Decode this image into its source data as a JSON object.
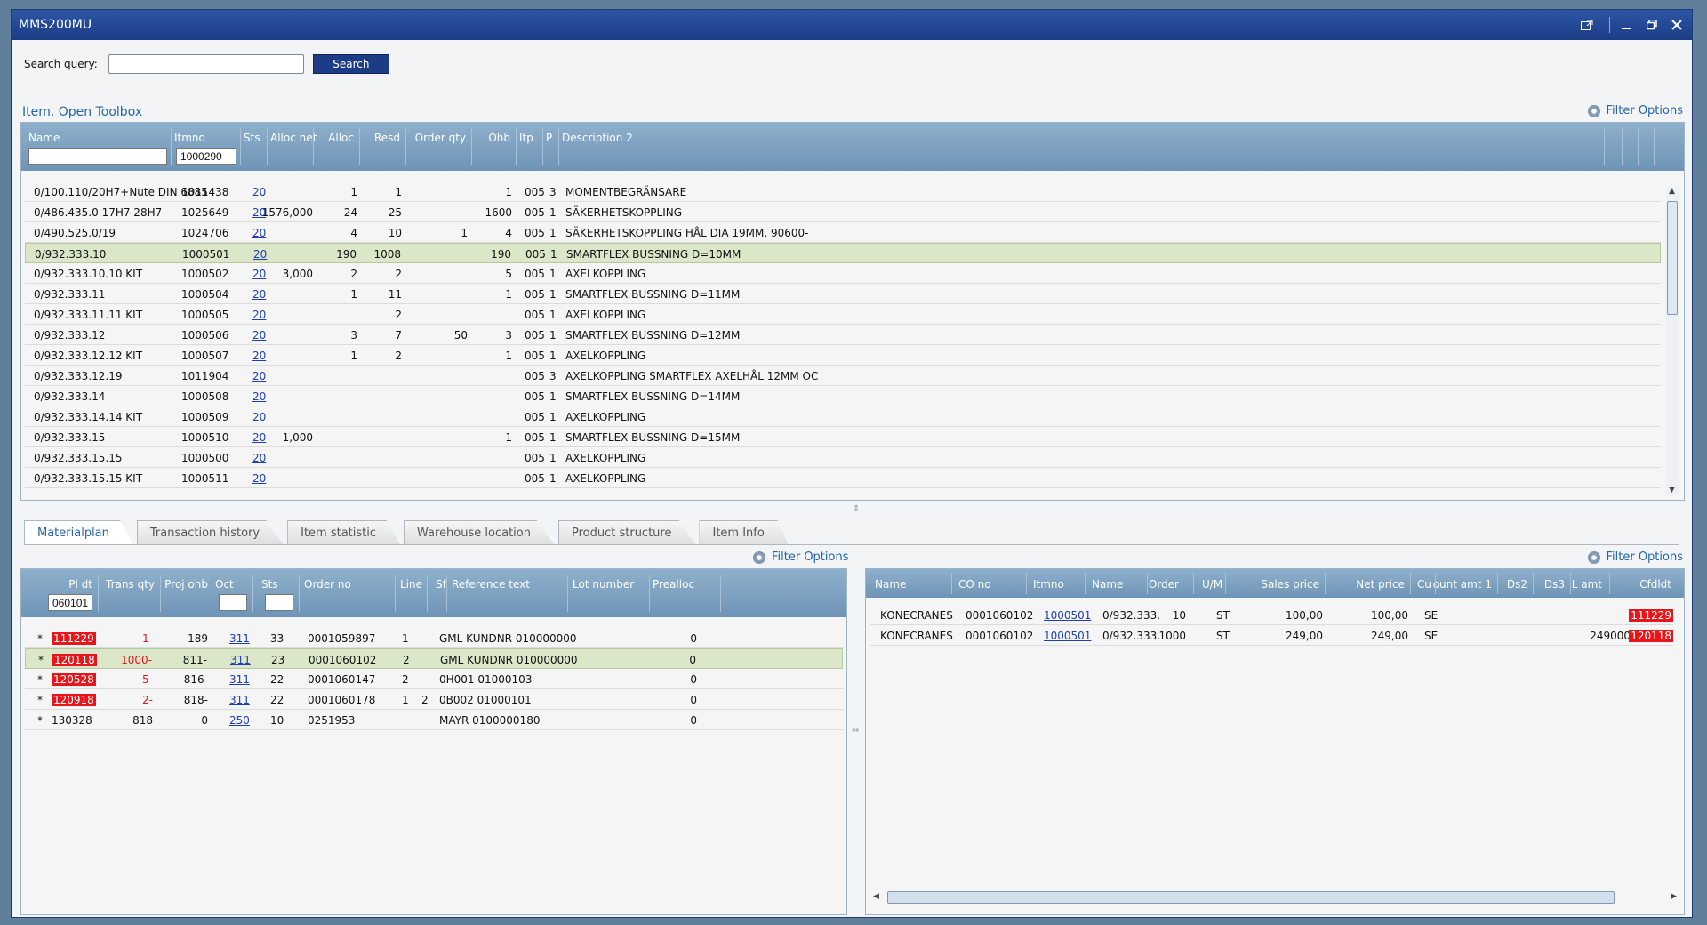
{
  "window": {
    "title": "MMS200MU"
  },
  "search": {
    "label": "Search query:",
    "value": "",
    "button": "Search"
  },
  "toolbox": {
    "title": "Item. Open Toolbox",
    "filter_options": "Filter Options"
  },
  "top_grid": {
    "columns": [
      "Name",
      "Itmno",
      "Sts",
      "Alloc net",
      "Alloc",
      "Resd",
      "Order qty",
      "Ohb",
      "Itp",
      "P",
      "Description 2"
    ],
    "filter_name": "",
    "filter_itmno": "1000290",
    "rows": [
      [
        "0/100.110/20H7+Nute DIN 6885",
        "1011438",
        "20",
        "",
        "1",
        "1",
        "",
        "1",
        "005",
        "3",
        "MOMENTBEGRÄNSARE"
      ],
      [
        "0/486.435.0 17H7 28H7",
        "1025649",
        "20",
        "1576,000",
        "24",
        "25",
        "",
        "1600",
        "005",
        "1",
        "SÄKERHETSKOPPLING"
      ],
      [
        "0/490.525.0/19",
        "1024706",
        "20",
        "",
        "4",
        "10",
        "1",
        "4",
        "005",
        "1",
        "SÄKERHETSKOPPLING HÅL DIA 19MM, 90600-"
      ],
      [
        "0/932.333.10",
        "1000501",
        "20",
        "",
        "190",
        "1008",
        "",
        "190",
        "005",
        "1",
        "SMARTFLEX BUSSNING D=10MM"
      ],
      [
        "0/932.333.10.10 KIT",
        "1000502",
        "20",
        "3,000",
        "2",
        "2",
        "",
        "5",
        "005",
        "1",
        "AXELKOPPLING"
      ],
      [
        "0/932.333.11",
        "1000504",
        "20",
        "",
        "1",
        "11",
        "",
        "1",
        "005",
        "1",
        "SMARTFLEX BUSSNING D=11MM"
      ],
      [
        "0/932.333.11.11 KIT",
        "1000505",
        "20",
        "",
        "",
        "2",
        "",
        "",
        "005",
        "1",
        "AXELKOPPLING"
      ],
      [
        "0/932.333.12",
        "1000506",
        "20",
        "",
        "3",
        "7",
        "50",
        "3",
        "005",
        "1",
        "SMARTFLEX BUSSNING D=12MM"
      ],
      [
        "0/932.333.12.12 KIT",
        "1000507",
        "20",
        "",
        "1",
        "2",
        "",
        "1",
        "005",
        "1",
        "AXELKOPPLING"
      ],
      [
        "0/932.333.12.19",
        "1011904",
        "20",
        "",
        "",
        "",
        "",
        "",
        "005",
        "3",
        "AXELKOPPLING SMARTFLEX AXELHÅL 12MM OC"
      ],
      [
        "0/932.333.14",
        "1000508",
        "20",
        "",
        "",
        "",
        "",
        "",
        "005",
        "1",
        "SMARTFLEX BUSSNING D=14MM"
      ],
      [
        "0/932.333.14.14 KIT",
        "1000509",
        "20",
        "",
        "",
        "",
        "",
        "",
        "005",
        "1",
        "AXELKOPPLING"
      ],
      [
        "0/932.333.15",
        "1000510",
        "20",
        "1,000",
        "",
        "",
        "",
        "1",
        "005",
        "1",
        "SMARTFLEX BUSSNING D=15MM"
      ],
      [
        "0/932.333.15.15",
        "1000500",
        "20",
        "",
        "",
        "",
        "",
        "",
        "005",
        "1",
        "AXELKOPPLING"
      ],
      [
        "0/932.333.15.15 KIT",
        "1000511",
        "20",
        "",
        "",
        "",
        "",
        "",
        "005",
        "1",
        "AXELKOPPLING"
      ]
    ],
    "selected_row": 3
  },
  "tabs": [
    "Materialplan",
    "Transaction history",
    "Item statistic",
    "Warehouse location",
    "Product structure",
    "Item Info"
  ],
  "active_tab": 0,
  "left_grid": {
    "filter_options": "Filter Options",
    "columns": [
      "Pl dt",
      "Trans qty",
      "Proj ohb",
      "Oct",
      "Sts",
      "Order no",
      "Line",
      "Sf",
      "Reference text",
      "Lot number",
      "Prealloc"
    ],
    "filter_pldt": "060101",
    "filter_oct": "",
    "filter_sts": "",
    "rows": [
      [
        "*",
        "111229",
        "1-",
        "189",
        "311",
        "33",
        "0001059897",
        "1",
        "",
        "GML KUNDNR 010000000",
        "",
        "0"
      ],
      [
        "*",
        "120118",
        "1000-",
        "811-",
        "311",
        "23",
        "0001060102",
        "2",
        "",
        "GML KUNDNR 010000000",
        "",
        "0"
      ],
      [
        "*",
        "120528",
        "5-",
        "816-",
        "311",
        "22",
        "0001060147",
        "2",
        "",
        "0H001    01000103",
        "",
        "0"
      ],
      [
        "*",
        "120918",
        "2-",
        "818-",
        "311",
        "22",
        "0001060178",
        "1",
        "2",
        "0B002    01000101",
        "",
        "0"
      ],
      [
        "*",
        "130328",
        "818",
        "0",
        "250",
        "10",
        "0251953",
        "",
        "",
        "MAYR     0100000180",
        "",
        "0"
      ]
    ],
    "red_rows": [
      0,
      1,
      2,
      3
    ],
    "selected_row": 1
  },
  "right_grid": {
    "filter_options": "Filter Options",
    "columns": [
      "Name",
      "CO no",
      "Itmno",
      "Name",
      "Order",
      "U/M",
      "Sales price",
      "Net price",
      "Cu",
      "ount amt 1",
      "Ds2",
      "Ds3",
      "L amt",
      "Cfdldt"
    ],
    "rows": [
      [
        "KONECRANES",
        "0001060102",
        "1000501",
        "0/932.333.",
        "10",
        "ST",
        "100,00",
        "100,00",
        "SE",
        "",
        "",
        "",
        "",
        "111229"
      ],
      [
        "KONECRANES",
        "0001060102",
        "1000501",
        "0/932.333.",
        "1000",
        "ST",
        "249,00",
        "249,00",
        "SE",
        "",
        "",
        "",
        "249000",
        "120118"
      ]
    ]
  },
  "colors": {
    "title_bar": "#1b3d86",
    "header": "#7ea3c2",
    "selected_row": "#dbe7c8",
    "alert": "#e8161a",
    "link": "#1f3fae"
  },
  "icons": [
    "popout-icon",
    "minimize-icon",
    "restore-icon",
    "close-icon",
    "filter-options-icon"
  ]
}
